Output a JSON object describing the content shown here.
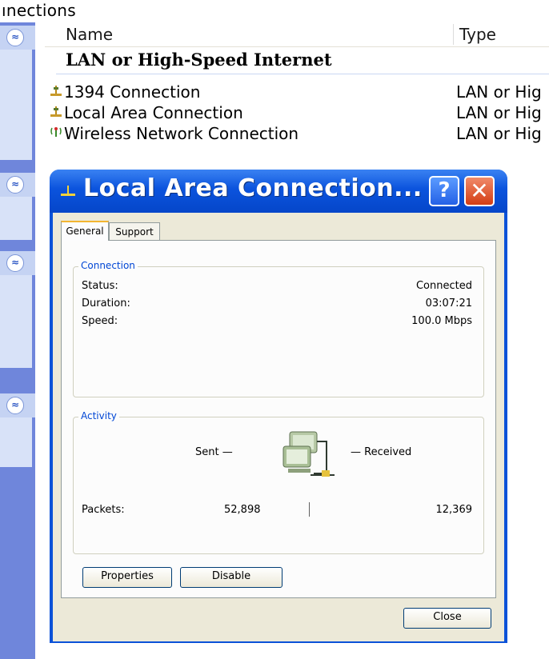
{
  "window": {
    "partial_title": "ınections"
  },
  "list": {
    "columns": {
      "name": "Name",
      "type": "Type"
    },
    "group_header": "LAN or High-Speed Internet",
    "rows": [
      {
        "name": "1394 Connection",
        "type": "LAN or Hig",
        "icon": "lan-plug-icon"
      },
      {
        "name": "Local Area Connection",
        "type": "LAN or Hig",
        "icon": "lan-plug-icon"
      },
      {
        "name": "Wireless Network Connection",
        "type": "LAN or Hig",
        "icon": "wireless-icon"
      }
    ]
  },
  "sidebar": {
    "collapse_glyph": "≈"
  },
  "dialog": {
    "title": "Local Area Connection...",
    "help_glyph": "?",
    "close_glyph": "✕",
    "tabs": [
      {
        "label": "General"
      },
      {
        "label": "Support"
      }
    ],
    "connection": {
      "legend": "Connection",
      "status_label": "Status:",
      "status_value": "Connected",
      "duration_label": "Duration:",
      "duration_value": "03:07:21",
      "speed_label": "Speed:",
      "speed_value": "100.0 Mbps"
    },
    "activity": {
      "legend": "Activity",
      "sent_label": "Sent —",
      "received_label": "— Received",
      "packets_label": "Packets:",
      "packets_sent": "52,898",
      "packets_received": "12,369"
    },
    "buttons": {
      "properties": "Properties",
      "disable": "Disable",
      "close": "Close"
    }
  },
  "colors": {
    "titlebar": "#0b53dd",
    "sidebar": "#6f86db",
    "dialog_face": "#ece9d8",
    "close_button": "#d43d13",
    "help_button": "#2461e6"
  }
}
